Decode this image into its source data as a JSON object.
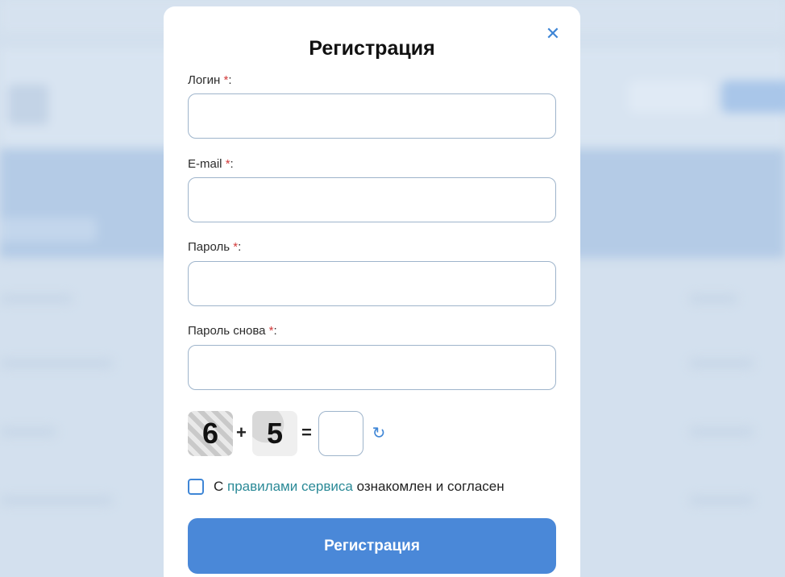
{
  "modal": {
    "title": "Регистрация",
    "close_icon": "close-icon"
  },
  "fields": [
    {
      "label": "Логин",
      "required_mark": "*",
      "colon": ":",
      "value": "",
      "placeholder": ""
    },
    {
      "label": "E-mail",
      "required_mark": "*",
      "colon": ":",
      "value": "",
      "placeholder": ""
    },
    {
      "label": "Пароль",
      "required_mark": "*",
      "colon": ":",
      "value": "",
      "placeholder": ""
    },
    {
      "label": "Пароль снова",
      "required_mark": "*",
      "colon": ":",
      "value": "",
      "placeholder": ""
    }
  ],
  "captcha": {
    "operand1": "6",
    "operator": "+",
    "operand2": "5",
    "equals": "=",
    "answer": "",
    "refresh_icon": "refresh-icon"
  },
  "agreement": {
    "prefix": "С",
    "link_text": "правилами сервиса",
    "suffix": "ознакомлен и согласен",
    "checked": false
  },
  "submit_label": "Регистрация",
  "colors": {
    "accent": "#4a88d8",
    "link": "#2b8a97",
    "required": "#d23a3a"
  }
}
